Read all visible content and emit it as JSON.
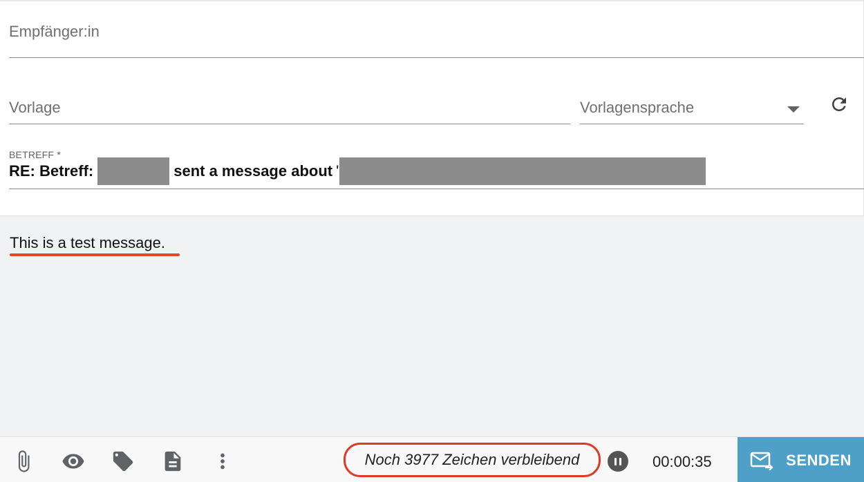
{
  "recipient": {
    "placeholder": "Empfänger:in"
  },
  "template": {
    "placeholder": "Vorlage"
  },
  "template_language": {
    "placeholder": "Vorlagensprache"
  },
  "subject": {
    "label": "BETREFF *",
    "prefix": "RE: Betreff:",
    "middle": "sent a message about",
    "tick": "'"
  },
  "body": {
    "text": "This is a test message."
  },
  "toolbar": {
    "icons": [
      "paperclip-icon",
      "eye-icon",
      "tag-icon",
      "document-icon",
      "more-vertical-icon"
    ],
    "char_counter": "Noch 3977 Zeichen verbleibend",
    "timer": "00:00:35",
    "send_label": "SENDEN"
  },
  "colors": {
    "send_button": "#4fa0c8",
    "annotation_red": "#e03a27",
    "body_background": "#f1f2f4"
  }
}
